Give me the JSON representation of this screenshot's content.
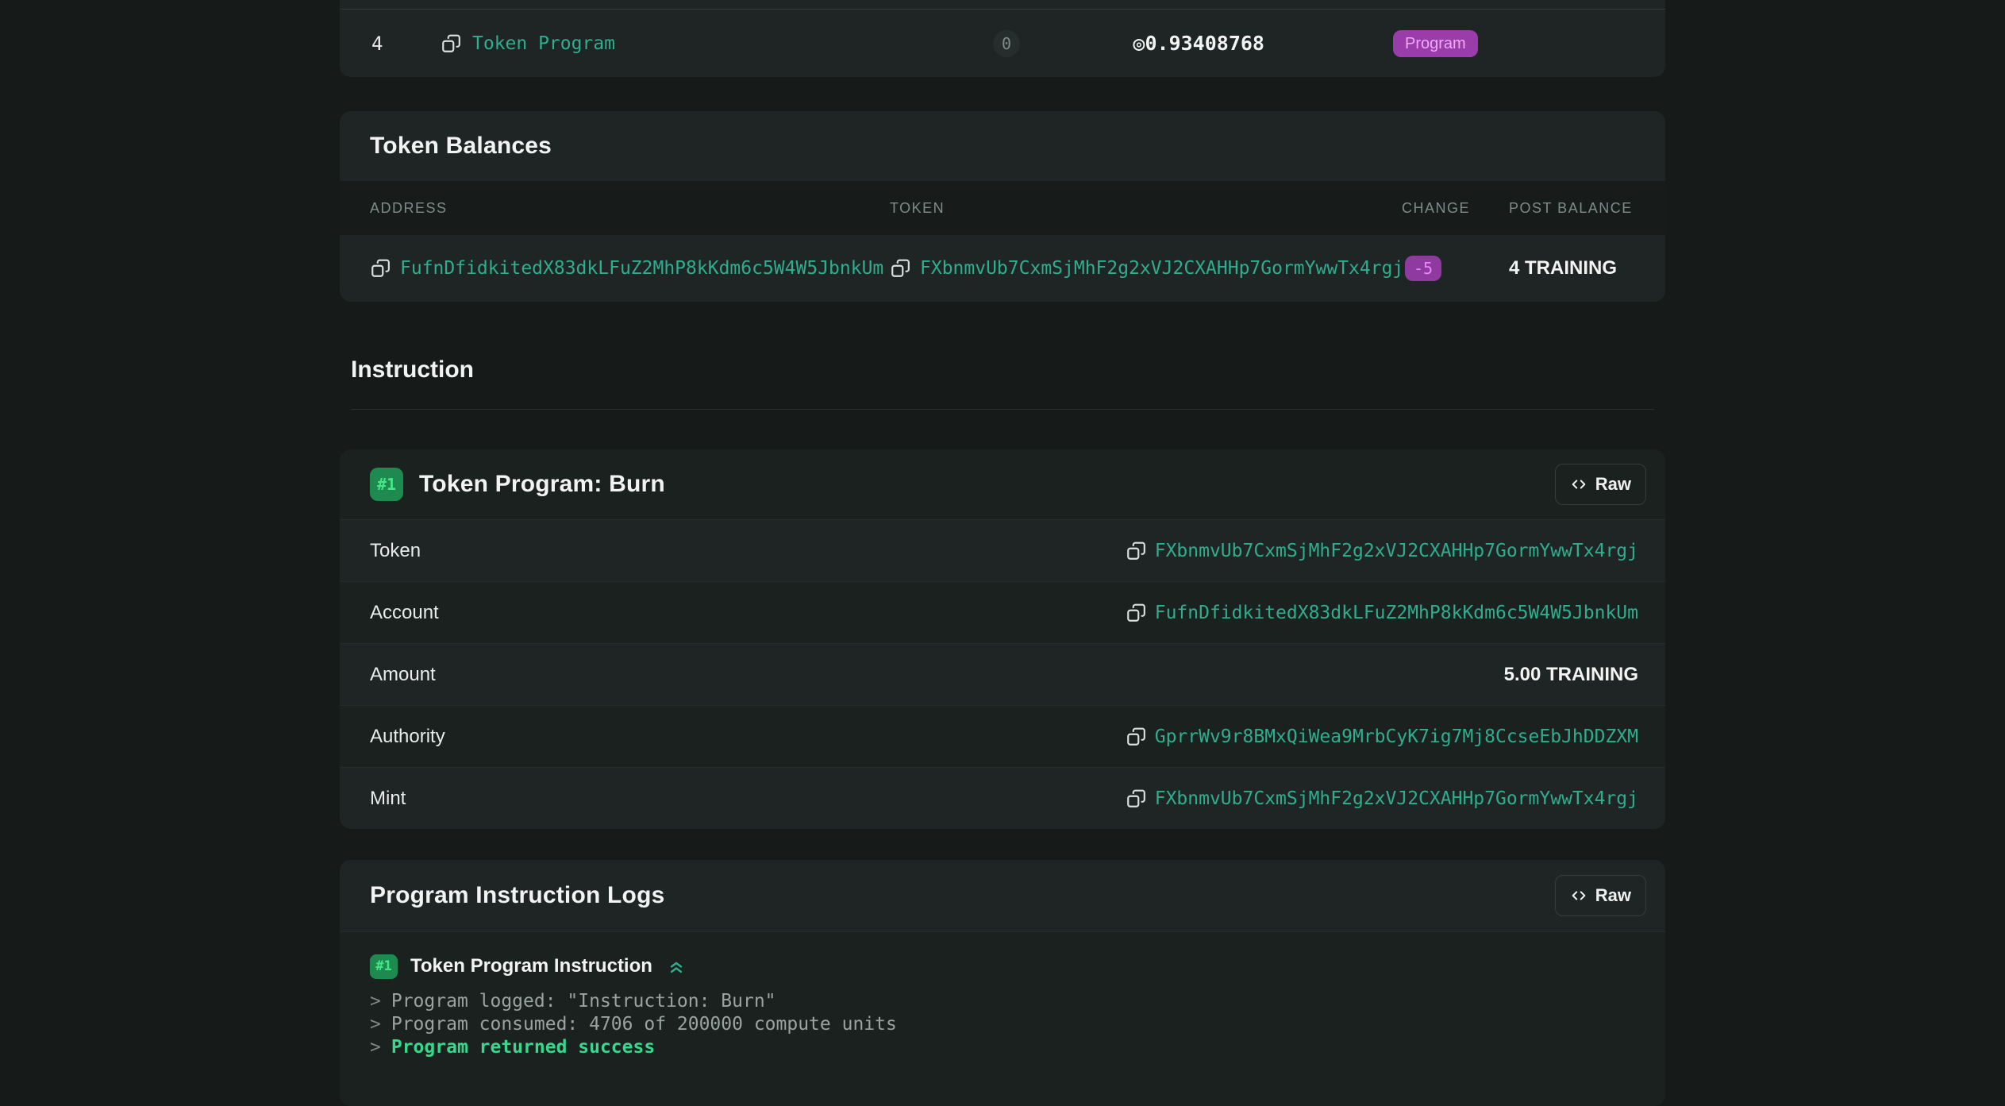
{
  "top_table": {
    "row": {
      "index": "4",
      "program_name": "Token Program",
      "invocations": "0",
      "sol_amount": "◎0.93408768",
      "tag": "Program"
    }
  },
  "token_balances": {
    "title": "Token Balances",
    "columns": {
      "address": "ADDRESS",
      "token": "TOKEN",
      "change": "CHANGE",
      "post_balance": "POST BALANCE"
    },
    "row": {
      "address": "FufnDfidkitedX83dkLFuZ2MhP8kKdm6c5W4W5JbnkUm",
      "token": "FXbnmvUb7CxmSjMhF2g2xVJ2CXAHHp7GormYwwTx4rgj",
      "change": "-5",
      "post_balance": "4 TRAINING"
    }
  },
  "instruction_section": {
    "heading": "Instruction"
  },
  "instruction_card": {
    "index_badge": "#1",
    "title": "Token Program: Burn",
    "raw_button": "Raw",
    "rows": [
      {
        "label": "Token",
        "value": "FXbnmvUb7CxmSjMhF2g2xVJ2CXAHHp7GormYwwTx4rgj"
      },
      {
        "label": "Account",
        "value": "FufnDfidkitedX83dkLFuZ2MhP8kKdm6c5W4W5JbnkUm"
      },
      {
        "label": "Amount",
        "value": "5.00 TRAINING"
      },
      {
        "label": "Authority",
        "value": "GprrWv9r8BMxQiWea9MrbCyK7ig7Mj8CcseEbJhDDZXM"
      },
      {
        "label": "Mint",
        "value": "FXbnmvUb7CxmSjMhF2g2xVJ2CXAHHp7GormYwwTx4rgj"
      }
    ]
  },
  "logs_card": {
    "title": "Program Instruction Logs",
    "raw_button": "Raw",
    "group": {
      "index_badge": "#1",
      "title": "Token Program Instruction"
    },
    "lines": [
      {
        "prefix": ">",
        "text": "Program logged: \"Instruction: Burn\""
      },
      {
        "prefix": ">",
        "text": "Program consumed: 4706 of 200000 compute units"
      },
      {
        "prefix": ">",
        "text": "Program returned success"
      }
    ]
  },
  "colors": {
    "page_bg": "#161a19",
    "card_bg": "#1f2524",
    "card_bg_dark": "#1b211f",
    "accent_green": "#2fae8f",
    "success_green": "#36d98c",
    "badge_green_bg": "#1e8a4f",
    "badge_green_text": "#44e786",
    "badge_purple_bg": "#9a3dab",
    "badge_purple_text": "#f0a9fb"
  }
}
